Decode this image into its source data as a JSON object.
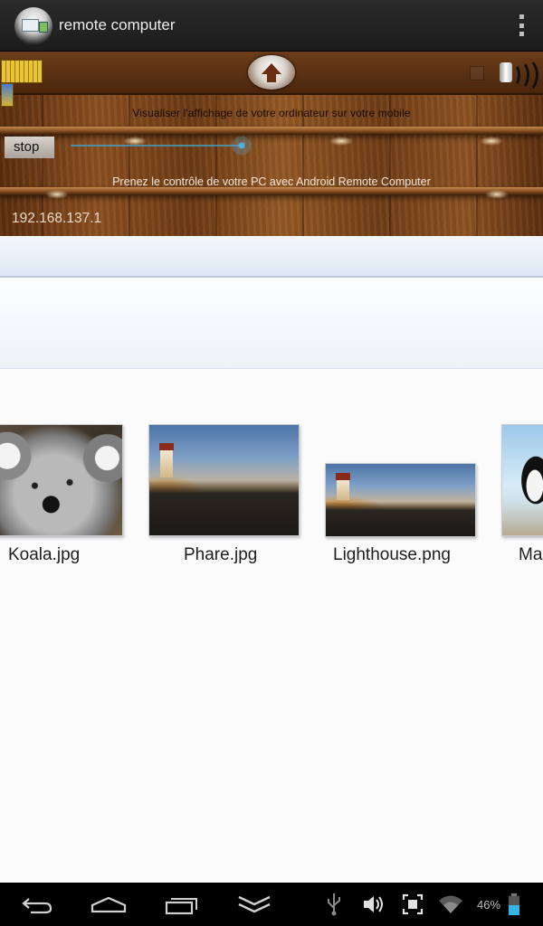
{
  "action_bar": {
    "title": "remote computer",
    "overflow_icon": "overflow-menu-icon"
  },
  "remote_panel": {
    "keyboard_icon": "keyboard-icon",
    "upload_icon": "upload-arrow-icon",
    "speaker_icon": "speaker-icon",
    "visualize_text": "Visualiser l'affichage de votre ordinateur sur votre mobile",
    "stop_label": "stop",
    "slider_value_percent": 100,
    "control_text": "Prenez le contrôle de votre PC avec Android Remote Computer",
    "ip_address": "192.168.137.1"
  },
  "remote_screen": {
    "files": [
      {
        "name": "Koala.jpg",
        "image": "koala"
      },
      {
        "name": "Phare.jpg",
        "image": "phare"
      },
      {
        "name": "Lighthouse.png",
        "image": "lighthouse"
      },
      {
        "name": "Ma",
        "image": "penguin"
      }
    ]
  },
  "system_bar": {
    "back_icon": "back-icon",
    "home_icon": "home-icon",
    "recents_icon": "recent-apps-icon",
    "hide_keyboard_icon": "hide-keyboard-icon",
    "usb_icon": "usb-icon",
    "volume_icon": "volume-icon",
    "screenshot_icon": "screenshot-icon",
    "wifi_icon": "wifi-icon",
    "battery_percent": "46%",
    "battery_icon": "battery-icon"
  }
}
